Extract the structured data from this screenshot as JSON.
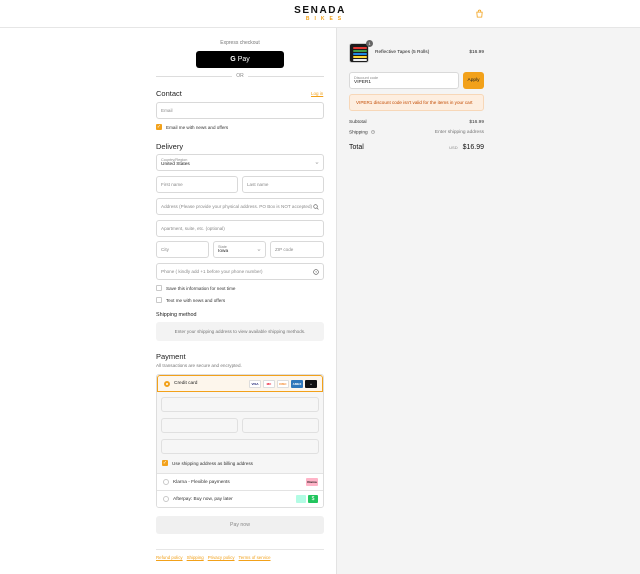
{
  "header": {
    "brand": "SENADA",
    "brand_sub": "BIKES",
    "cart_icon": "shopping-bag-icon"
  },
  "express": {
    "label": "Express checkout",
    "gpay_label": "Pay",
    "or_label": "OR"
  },
  "contact": {
    "title": "Contact",
    "login_label": "Log in",
    "email_placeholder": "Email",
    "news_label": "Email me with news and offers",
    "news_checked": true
  },
  "delivery": {
    "title": "Delivery",
    "country_label": "Country/Region",
    "country_value": "United States",
    "first_name_placeholder": "First name",
    "last_name_placeholder": "Last name",
    "address_placeholder": "Address (Please provide your physical address. PO Box is NOT accepted)",
    "apartment_placeholder": "Apartment, suite, etc. (optional)",
    "city_placeholder": "City",
    "state_label": "State",
    "state_value": "Iowa",
    "zip_placeholder": "ZIP code",
    "phone_placeholder": "Phone ( kindly add +1 before your phone number)",
    "save_info_label": "Save this information for next time",
    "text_me_label": "Text me with news and offers"
  },
  "shipping_method": {
    "title": "Shipping method",
    "message": "Enter your shipping address to view available shipping methods."
  },
  "payment": {
    "title": "Payment",
    "subtitle": "All transactions are secure and encrypted.",
    "credit_card_label": "Credit card",
    "card_brands": [
      "VISA",
      "MC",
      "DISC",
      "AMEX",
      "+"
    ],
    "billing_label": "Use shipping address as billing address",
    "klarna_label": "Klarna - Flexible payments",
    "klarna_badge": "Klarna",
    "afterpay_label": "Afterpay: Buy now, pay later",
    "afterpay_badge": "$",
    "pay_now_label": "Pay now"
  },
  "footer": {
    "links": [
      "Refund policy",
      "Shipping",
      "Privacy policy",
      "Terms of service"
    ]
  },
  "summary": {
    "quantity": "1",
    "product_name": "Reflective Tapes (5 Rolls)",
    "product_price": "$16.99",
    "discount_label": "Discount code",
    "discount_value": "VIPER1",
    "apply_label": "Apply",
    "error_message": "VIPER1 discount code isn't valid for the items in your cart",
    "subtotal_label": "Subtotal",
    "subtotal_value": "$16.99",
    "shipping_label": "Shipping",
    "shipping_value": "Enter shipping address",
    "total_label": "Total",
    "total_currency": "USD",
    "total_value": "$16.99"
  },
  "colors": {
    "accent": "#f2a11a",
    "error_bg": "#fdeee0",
    "error_text": "#c24a00",
    "panel_bg": "#f4f4f4"
  }
}
